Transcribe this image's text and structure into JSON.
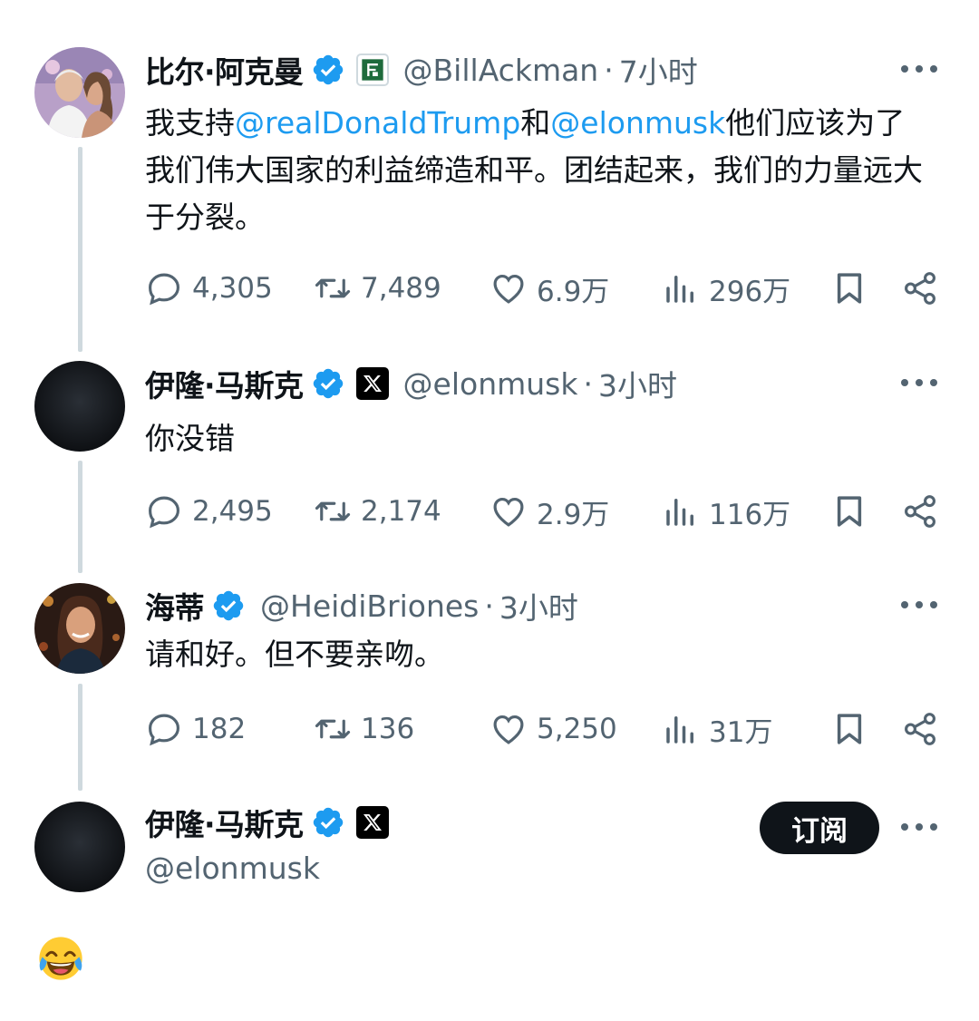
{
  "tweets": [
    {
      "name": "比尔·阿克曼",
      "handle": "@BillAckman",
      "dot": "·",
      "time": "7小时",
      "affiliation": "pershing",
      "text": {
        "p1": "我支持",
        "m1": "@realDonaldTrump",
        "p2": "和",
        "m2": "@elonmusk",
        "p3": "他们应该为了我们伟大国家的利益缔造和平。团结起来，我们的力量远大于分裂。"
      },
      "replies": "4,305",
      "retweets": "7,489",
      "likes": "6.9万",
      "views": "296万"
    },
    {
      "name": "伊隆·马斯克",
      "handle": "@elonmusk",
      "dot": "·",
      "time": "3小时",
      "affiliation": "x",
      "text": "你没错",
      "replies": "2,495",
      "retweets": "2,174",
      "likes": "2.9万",
      "views": "116万"
    },
    {
      "name": "海蒂",
      "handle": "@HeidiBriones",
      "dot": "·",
      "time": "3小时",
      "text": "请和好。但不要亲吻。",
      "replies": "182",
      "retweets": "136",
      "likes": "5,250",
      "views": "31万"
    },
    {
      "name": "伊隆·马斯克",
      "handle": "@elonmusk",
      "affiliation": "x",
      "follow_label": "订阅",
      "text_emoji": "face-with-tears-of-joy"
    }
  ],
  "icons": {
    "reply": "reply-icon",
    "retweet": "retweet-icon",
    "like": "like-icon",
    "views": "views-icon",
    "bookmark": "bookmark-icon",
    "share": "share-icon",
    "more": "more-icon",
    "verified": "verified-badge-icon"
  },
  "colors": {
    "link": "#1d9bf0",
    "secondary_text": "#536471",
    "primary_text": "#0f1419",
    "thread_line": "#cfd9de",
    "verified": "#1d9bf0"
  }
}
